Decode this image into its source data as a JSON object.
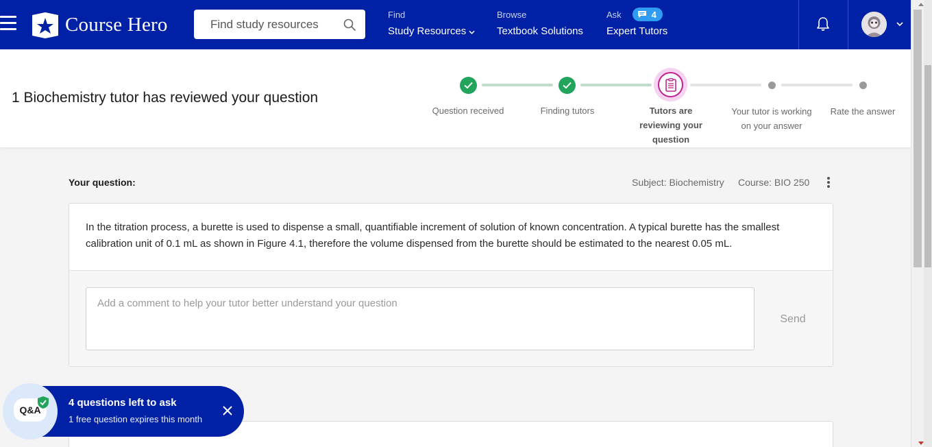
{
  "nav": {
    "logo_text": "Course Hero",
    "search_placeholder": "Find study resources",
    "find": {
      "small": "Find",
      "big": "Study Resources"
    },
    "browse": {
      "small": "Browse",
      "big": "Textbook Solutions"
    },
    "ask": {
      "small": "Ask",
      "badge_count": "4",
      "big": "Expert Tutors"
    },
    "brand_color": "#0021a5"
  },
  "status": {
    "title": "1 Biochemistry tutor has reviewed your question",
    "steps": [
      {
        "label": "Question received",
        "state": "done"
      },
      {
        "label": "Finding tutors",
        "state": "done"
      },
      {
        "label_lines": [
          "Tutors are",
          "reviewing your",
          "question"
        ],
        "state": "current"
      },
      {
        "label_lines": [
          "Your tutor is working",
          "on your answer"
        ],
        "state": "pending"
      },
      {
        "label": "Rate the answer",
        "state": "pending"
      }
    ]
  },
  "question": {
    "heading": "Your question:",
    "subject": "Subject: Biochemistry",
    "course": "Course: BIO 250",
    "text": "In the titration process, a burette is used to dispense a small, quantifiable increment of solution of known concentration. A typical burette has the smallest calibration unit of 0.1 mL as shown in Figure 4.1, therefore the volume dispensed from the burette should be estimated to the nearest 0.05 mL.",
    "comment_placeholder": "Add a comment to help your tutor better understand your question",
    "send_label": "Send"
  },
  "qa_toast": {
    "bubble_label": "Q&A",
    "title": "4 questions left to ask",
    "subtitle": "1 free question expires this month"
  }
}
